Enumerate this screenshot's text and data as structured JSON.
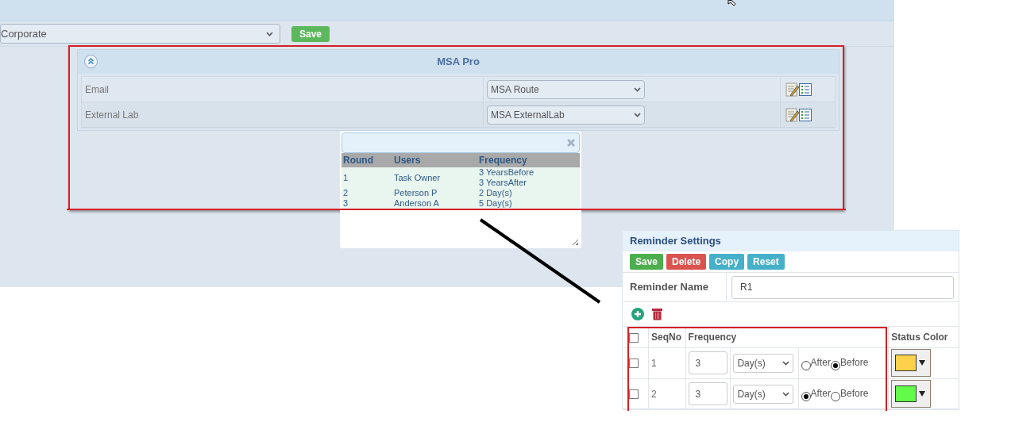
{
  "toolbar": {
    "select_value": "Corporate",
    "save_label": "Save"
  },
  "msa_panel": {
    "title": "MSA Pro",
    "rows": [
      {
        "label": "Email",
        "select_value": "MSA Route"
      },
      {
        "label": "External Lab",
        "select_value": "MSA ExternalLab"
      }
    ]
  },
  "popup": {
    "columns": [
      "Round",
      "Users",
      "Frequency"
    ],
    "rows": [
      {
        "round": "1",
        "user": "Task Owner",
        "frequency": [
          "3 YearsBefore",
          "3 YearsAfter"
        ]
      },
      {
        "round": "2",
        "user": "Peterson P",
        "frequency": [
          "2 Day(s)"
        ]
      },
      {
        "round": "3",
        "user": "Anderson A",
        "frequency": [
          "5 Day(s)"
        ]
      }
    ]
  },
  "reminder": {
    "title": "Reminder Settings",
    "buttons": [
      {
        "label": "Save",
        "kind": "save"
      },
      {
        "label": "Delete",
        "kind": "delete"
      },
      {
        "label": "Copy",
        "kind": "copy"
      },
      {
        "label": "Reset",
        "kind": "reset"
      }
    ],
    "name_label": "Reminder Name",
    "name_value": "R1",
    "columns": [
      "SeqNo",
      "Frequency",
      "Status Color"
    ],
    "header_checked": false,
    "rows": [
      {
        "checked": false,
        "seq": "1",
        "amount": "3",
        "unit": "Day(s)",
        "options": [
          {
            "label": "After",
            "selected": false
          },
          {
            "label": "Before",
            "selected": true
          }
        ],
        "color": "#fdd14b"
      },
      {
        "checked": false,
        "seq": "2",
        "amount": "3",
        "unit": "Day(s)",
        "options": [
          {
            "label": "After",
            "selected": true
          },
          {
            "label": "Before",
            "selected": false
          }
        ],
        "color": "#62fb4a"
      }
    ]
  }
}
